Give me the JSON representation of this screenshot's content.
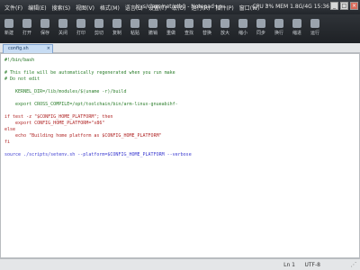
{
  "titlebar": {
    "menus": [
      "文件(F)",
      "编辑(E)",
      "搜索(S)",
      "视图(V)",
      "格式(M)",
      "语言(L)",
      "设置(T)",
      "宏(O)",
      "运行(R)",
      "插件(P)",
      "窗口(W)",
      "?"
    ],
    "title": "/sys/class/net/eth0 - Notepad++",
    "sysinfo": "CPU 3%  MEM 1.8G/4G  15:36",
    "buttons": {
      "min": "_",
      "max": "□",
      "close": "×"
    }
  },
  "toolbar": {
    "items": [
      {
        "icon": "new-file-icon",
        "label": "新建"
      },
      {
        "icon": "open-icon",
        "label": "打开"
      },
      {
        "icon": "save-icon",
        "label": "保存"
      },
      {
        "icon": "close-file-icon",
        "label": "关闭"
      },
      {
        "icon": "print-icon",
        "label": "打印"
      },
      {
        "icon": "cut-icon",
        "label": "剪切"
      },
      {
        "icon": "copy-icon",
        "label": "复制"
      },
      {
        "icon": "paste-icon",
        "label": "粘贴"
      },
      {
        "icon": "undo-icon",
        "label": "撤销"
      },
      {
        "icon": "redo-icon",
        "label": "重做"
      },
      {
        "icon": "find-icon",
        "label": "查找"
      },
      {
        "icon": "replace-icon",
        "label": "替换"
      },
      {
        "icon": "zoom-in-icon",
        "label": "放大"
      },
      {
        "icon": "zoom-out-icon",
        "label": "缩小"
      },
      {
        "icon": "sync-icon",
        "label": "同步"
      },
      {
        "icon": "wrap-icon",
        "label": "换行"
      },
      {
        "icon": "indent-icon",
        "label": "缩进"
      },
      {
        "icon": "run-icon",
        "label": "运行"
      }
    ]
  },
  "tab": {
    "label": "config.sh",
    "close": "×"
  },
  "editor": {
    "lines": [
      {
        "text": "#!/bin/bash",
        "color": "#1b6e1b"
      },
      {
        "text": "",
        "color": "#222222"
      },
      {
        "text": "# This file will be automatically regenerated when you run make",
        "color": "#2a7d2a"
      },
      {
        "text": "# Do not edit",
        "color": "#2a7d2a"
      },
      {
        "text": "",
        "color": "#222222"
      },
      {
        "text": "    KERNEL_DIR=/lib/modules/$(uname -r)/build",
        "color": "#2a7d2a"
      },
      {
        "text": "",
        "color": "#222222"
      },
      {
        "text": "    export CROSS_COMPILE=/opt/toolchain/bin/arm-linux-gnueabihf-",
        "color": "#2a7d2a"
      },
      {
        "text": "",
        "color": "#222222"
      },
      {
        "text": "if test -z \"$CONFIG_HOME_PLATFORM\"; then",
        "color": "#b02525"
      },
      {
        "text": "    export CONFIG_HOME_PLATFORM=\"x86\"",
        "color": "#b02525"
      },
      {
        "text": "else",
        "color": "#b02525"
      },
      {
        "text": "    echo \"Building home platform as $CONFIG_HOME_PLATFORM\"",
        "color": "#b02525"
      },
      {
        "text": "fi",
        "color": "#b02525"
      },
      {
        "text": "",
        "color": "#222222"
      },
      {
        "text": "source ./scripts/setenv.sh --platform=$CONFIG_HOME_PLATFORM --verbose",
        "color": "#3a3ad0"
      }
    ]
  },
  "status": {
    "position": "Ln 1",
    "encoding": "UTF-8",
    "grip": "⋰"
  }
}
